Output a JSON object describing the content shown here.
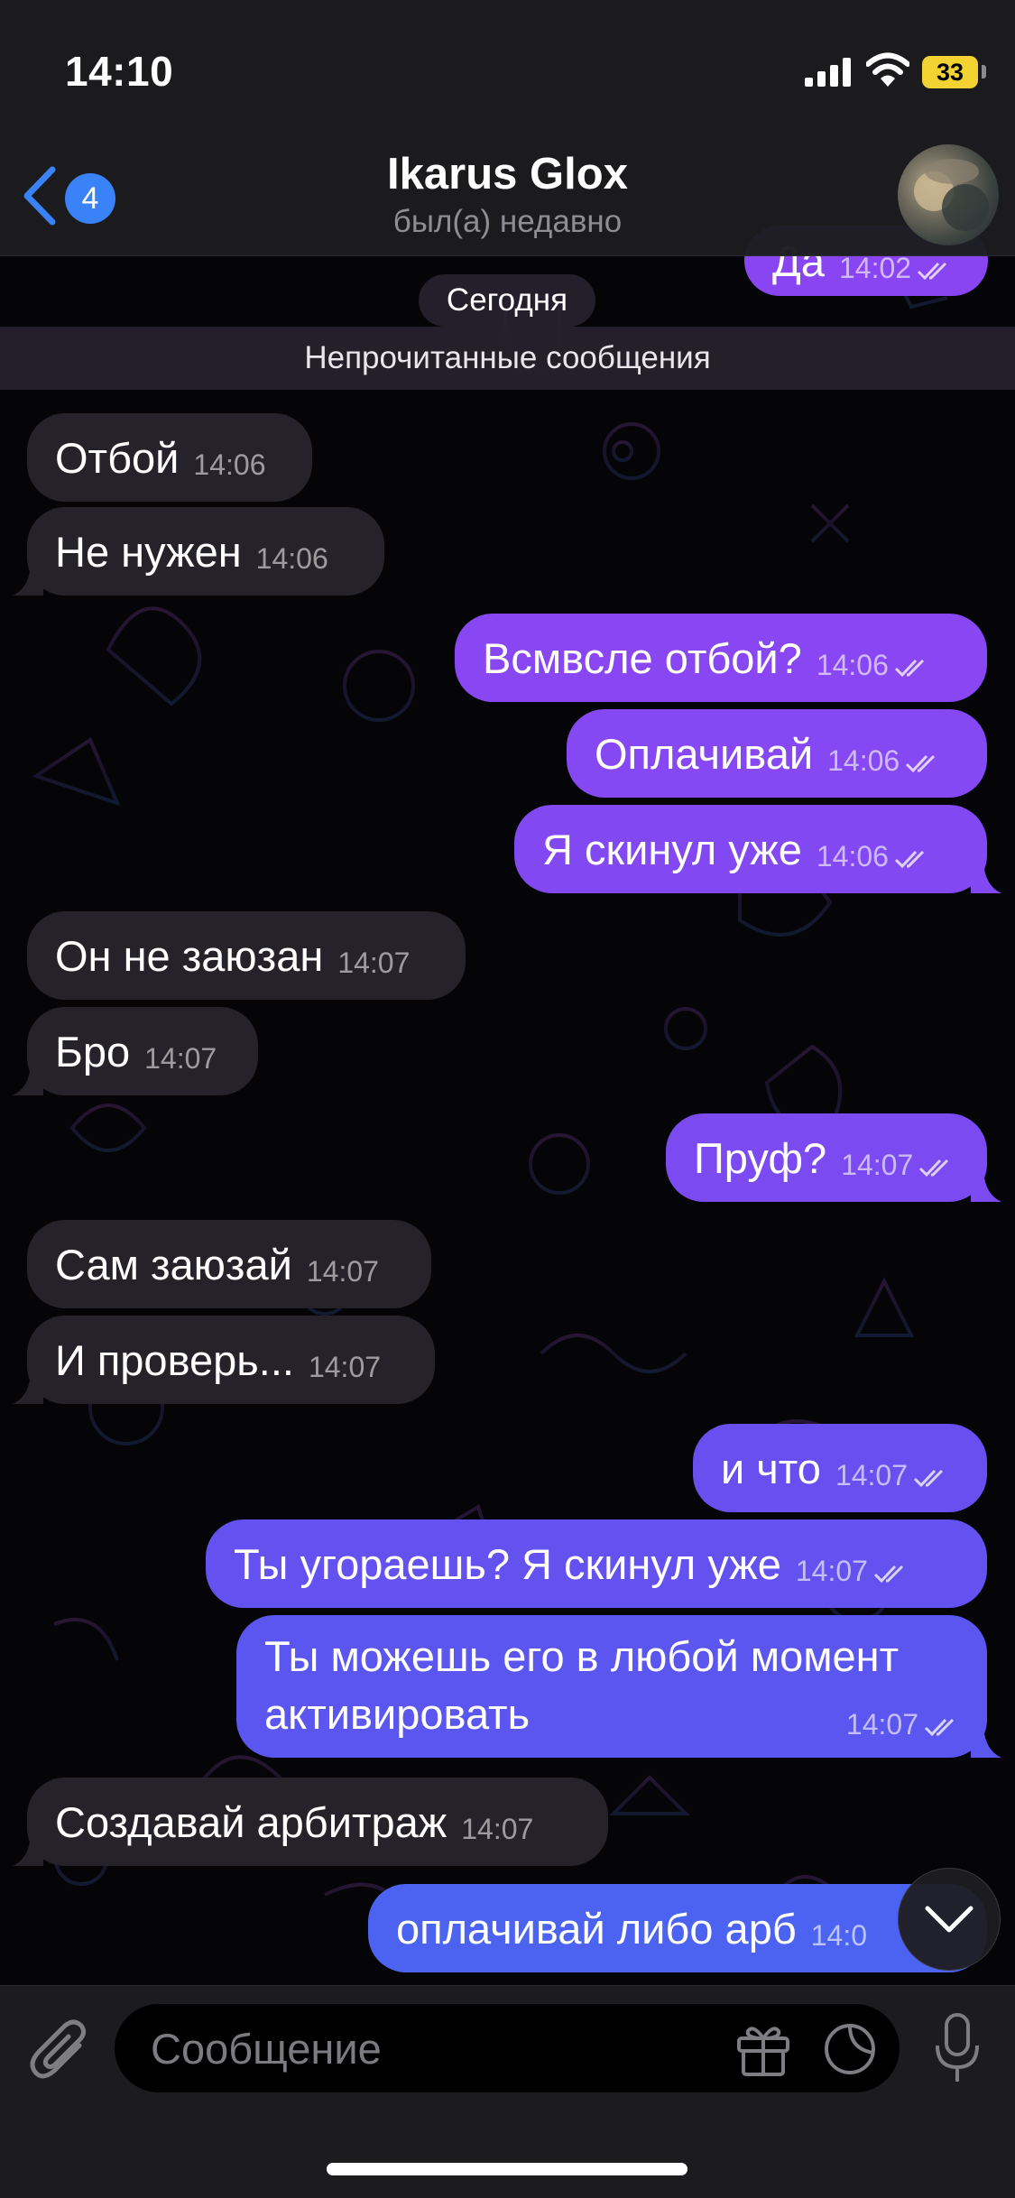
{
  "status_bar": {
    "time": "14:10",
    "battery": "33",
    "icons": [
      "cellular-signal-icon",
      "wifi-icon",
      "battery-icon"
    ]
  },
  "header": {
    "back_badge": "4",
    "title": "Ikarus Glox",
    "subtitle": "был(а) недавно",
    "icons": [
      "chevron-left-icon"
    ]
  },
  "chat": {
    "partial_top": {
      "text": "Да",
      "time": "14:02"
    },
    "date_label": "Сегодня",
    "unread_label": "Непрочитанные сообщения",
    "messages": [
      {
        "dir": "in",
        "text": "Отбой",
        "time": "14:06"
      },
      {
        "dir": "in",
        "text": "Не нужен",
        "time": "14:06"
      },
      {
        "dir": "out",
        "text": "Всмвсле отбой?",
        "time": "14:06"
      },
      {
        "dir": "out",
        "text": "Оплачивай",
        "time": "14:06"
      },
      {
        "dir": "out",
        "text": "Я скинул уже",
        "time": "14:06"
      },
      {
        "dir": "in",
        "text": "Он не заюзан",
        "time": "14:07"
      },
      {
        "dir": "in",
        "text": "Бро",
        "time": "14:07"
      },
      {
        "dir": "out",
        "text": "Пруф?",
        "time": "14:07"
      },
      {
        "dir": "in",
        "text": "Сам заюзай",
        "time": "14:07"
      },
      {
        "dir": "in",
        "text": "И проверь...",
        "time": "14:07"
      },
      {
        "dir": "out",
        "text": "и что",
        "time": "14:07"
      },
      {
        "dir": "out",
        "text": "Ты угораешь? Я скинул уже",
        "time": "14:07"
      },
      {
        "dir": "out",
        "text": "Ты можешь его в любой момент активировать",
        "time": "14:07"
      },
      {
        "dir": "in",
        "text": "Создавай арбитраж",
        "time": "14:07"
      },
      {
        "dir": "out",
        "text": "оплачивай либо арб",
        "time": "14:0"
      }
    ],
    "read_status_icon": "double-check-icon",
    "accent_in": "#262229",
    "accent_out_top": "#8a45f3",
    "accent_out_bottom": "#4c62f0"
  },
  "composer": {
    "placeholder": "Сообщение",
    "icons": [
      "paperclip-icon",
      "gift-icon",
      "sticker-icon",
      "microphone-icon",
      "chevron-down-icon"
    ]
  }
}
